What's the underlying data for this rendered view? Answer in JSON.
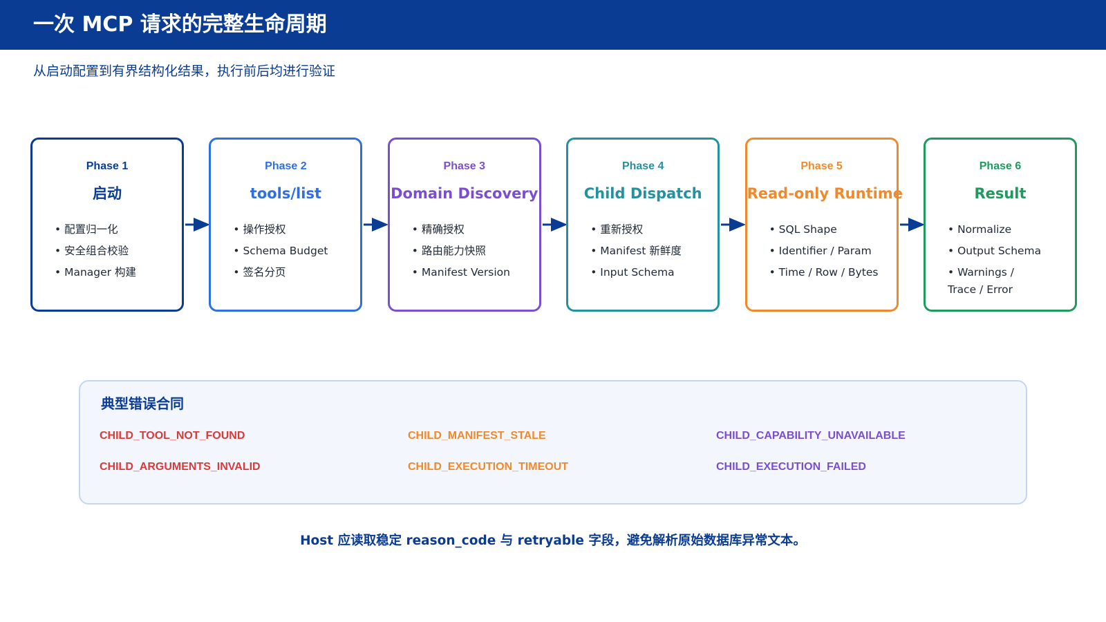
{
  "header": {
    "title": "一次 MCP 请求的完整生命周期"
  },
  "subtitle": "从启动配置到有界结构化结果，执行前后均进行验证",
  "phases": [
    {
      "label": "Phase 1",
      "name": "启动",
      "color": "#0b3c94",
      "items": [
        "• 配置归一化",
        "• 安全组合校验",
        "• Manager 构建"
      ]
    },
    {
      "label": "Phase 2",
      "name": "tools/list",
      "color": "#2f6fe0",
      "items": [
        "• 操作授权",
        "• Schema Budget",
        "• 签名分页"
      ]
    },
    {
      "label": "Phase 3",
      "name": "Domain Discovery",
      "color": "#7a4fcf",
      "items": [
        "• 精确授权",
        "• 路由能力快照",
        "• Manifest Version"
      ]
    },
    {
      "label": "Phase 4",
      "name": "Child Dispatch",
      "color": "#23919e",
      "items": [
        "• 重新授权",
        "• Manifest 新鲜度",
        "• Input Schema"
      ]
    },
    {
      "label": "Phase 5",
      "name": "Read-only Runtime",
      "color": "#ef8a2c",
      "items": [
        "• SQL Shape",
        "• Identifier / Param",
        "• Time / Row / Bytes"
      ]
    },
    {
      "label": "Phase 6",
      "name": "Result",
      "color": "#1f9a5f",
      "items": [
        "• Normalize",
        "• Output Schema",
        "• Warnings /",
        "Trace / Error"
      ]
    }
  ],
  "errors": {
    "title": "典型错误合同",
    "codes": [
      {
        "code": "CHILD_TOOL_NOT_FOUND",
        "color": "#d83a3a"
      },
      {
        "code": "CHILD_MANIFEST_STALE",
        "color": "#ef8a2c"
      },
      {
        "code": "CHILD_CAPABILITY_UNAVAILABLE",
        "color": "#7a4fcf"
      },
      {
        "code": "CHILD_ARGUMENTS_INVALID",
        "color": "#d83a3a"
      },
      {
        "code": "CHILD_EXECUTION_TIMEOUT",
        "color": "#ef8a2c"
      },
      {
        "code": "CHILD_EXECUTION_FAILED",
        "color": "#7a4fcf"
      }
    ]
  },
  "footer_note": "Host 应读取稳定 reason_code 与 retryable 字段，避免解析原始数据库异常文本。",
  "arrow_color": "#0b3c94"
}
